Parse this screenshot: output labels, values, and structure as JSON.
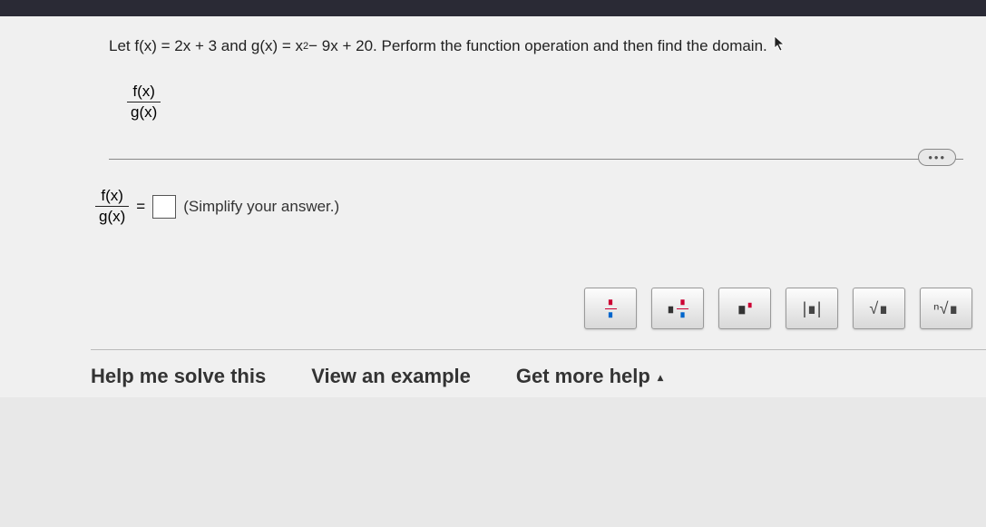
{
  "problem": {
    "prefix": "Let f(x) = 2x + 3 and g(x) = x",
    "exp": "2",
    "suffix": " − 9x + 20. Perform the function operation and then find the domain."
  },
  "expression": {
    "numerator": "f(x)",
    "denominator": "g(x)"
  },
  "answer": {
    "numerator": "f(x)",
    "denominator": "g(x)",
    "equals": "=",
    "hint": "(Simplify your answer.)"
  },
  "toolbar": {
    "fraction": "fraction",
    "mixed": "mixed-number",
    "exponent": "exponent",
    "abs": "|∎|",
    "sqrt": "√∎",
    "nthroot": "ⁿ√∎"
  },
  "help": {
    "solve": "Help me solve this",
    "example": "View an example",
    "more": "Get more help",
    "caret": "▴"
  },
  "more_dots": "•••"
}
